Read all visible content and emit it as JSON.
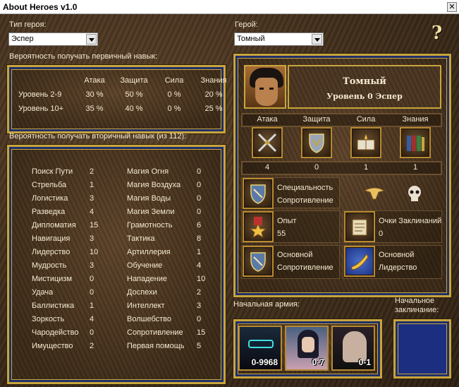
{
  "window": {
    "title": "About Heroes v1.0",
    "close_glyph": "✕"
  },
  "hero_type": {
    "label": "Тип героя:",
    "value": "Эспер"
  },
  "hero": {
    "label": "Герой:",
    "value": "Томный",
    "name": "Томный",
    "level_line": "Уровень 0 Эспер"
  },
  "help_glyph": "?",
  "primary": {
    "caption": "Вероятность получать первичный навык:",
    "columns": [
      "Атака",
      "Защита",
      "Сила",
      "Знания"
    ],
    "rows": [
      {
        "label": "Уровень 2-9",
        "values": [
          "30 %",
          "50 %",
          "0 %",
          "20 %"
        ]
      },
      {
        "label": "Уровень 10+",
        "values": [
          "35 %",
          "40 %",
          "0 %",
          "25 %"
        ]
      }
    ]
  },
  "secondary": {
    "caption": "Вероятность получать вторичный навык (из 112):",
    "left": [
      {
        "name": "Поиск Пути",
        "value": "2"
      },
      {
        "name": "Стрельба",
        "value": "1"
      },
      {
        "name": "Логистика",
        "value": "3"
      },
      {
        "name": "Разведка",
        "value": "4"
      },
      {
        "name": "Дипломатия",
        "value": "15"
      },
      {
        "name": "Навигация",
        "value": "3"
      },
      {
        "name": "Лидерство",
        "value": "10"
      },
      {
        "name": "Мудрость",
        "value": "3"
      },
      {
        "name": "Мистицизм",
        "value": "0"
      },
      {
        "name": "Удача",
        "value": "0"
      },
      {
        "name": "Баллистика",
        "value": "1"
      },
      {
        "name": "Зоркость",
        "value": "4"
      },
      {
        "name": "Чародейство",
        "value": "0"
      },
      {
        "name": "Имущество",
        "value": "2"
      }
    ],
    "right": [
      {
        "name": "Магия Огня",
        "value": "0"
      },
      {
        "name": "Магия Воздуха",
        "value": "0"
      },
      {
        "name": "Магия Воды",
        "value": "0"
      },
      {
        "name": "Магия Земли",
        "value": "0"
      },
      {
        "name": "Грамотность",
        "value": "6"
      },
      {
        "name": "Тактика",
        "value": "8"
      },
      {
        "name": "Артиллерия",
        "value": "1"
      },
      {
        "name": "Обучение",
        "value": "4"
      },
      {
        "name": "Нападение",
        "value": "10"
      },
      {
        "name": "Доспехи",
        "value": "2"
      },
      {
        "name": "Интеллект",
        "value": "3"
      },
      {
        "name": "Волшебство",
        "value": "0"
      },
      {
        "name": "Сопротивление",
        "value": "15"
      },
      {
        "name": "Первая помощь",
        "value": "5"
      }
    ]
  },
  "stats": {
    "labels": [
      "Атака",
      "Защита",
      "Сила",
      "Знания"
    ],
    "values": [
      "4",
      "0",
      "1",
      "1"
    ]
  },
  "specialty": {
    "line1": "Специальность",
    "line2": "Сопротивление"
  },
  "experience": {
    "label": "Опыт",
    "value": "55"
  },
  "spell_points": {
    "label": "Очки Заклинаний",
    "value": "0"
  },
  "skill1": {
    "line1": "Основной",
    "line2": "Сопротивление"
  },
  "skill2": {
    "line1": "Основной",
    "line2": "Лидерство"
  },
  "army": {
    "label": "Начальная армия:",
    "units": [
      {
        "count": "0-9968"
      },
      {
        "count": "0-7"
      },
      {
        "count": "0-1"
      }
    ]
  },
  "spell": {
    "label_line1": "Начальное",
    "label_line2": "заклинание:"
  },
  "colors": {
    "gold": "#c8a53c",
    "blue": "#1b2e80",
    "leather": "#3b2a1a"
  },
  "icons": [
    "attack-icon",
    "defense-icon",
    "power-icon",
    "knowledge-icon",
    "eagle-icon",
    "skull-icon",
    "medal-icon",
    "scroll-icon",
    "horn-icon",
    "shield-icon"
  ]
}
